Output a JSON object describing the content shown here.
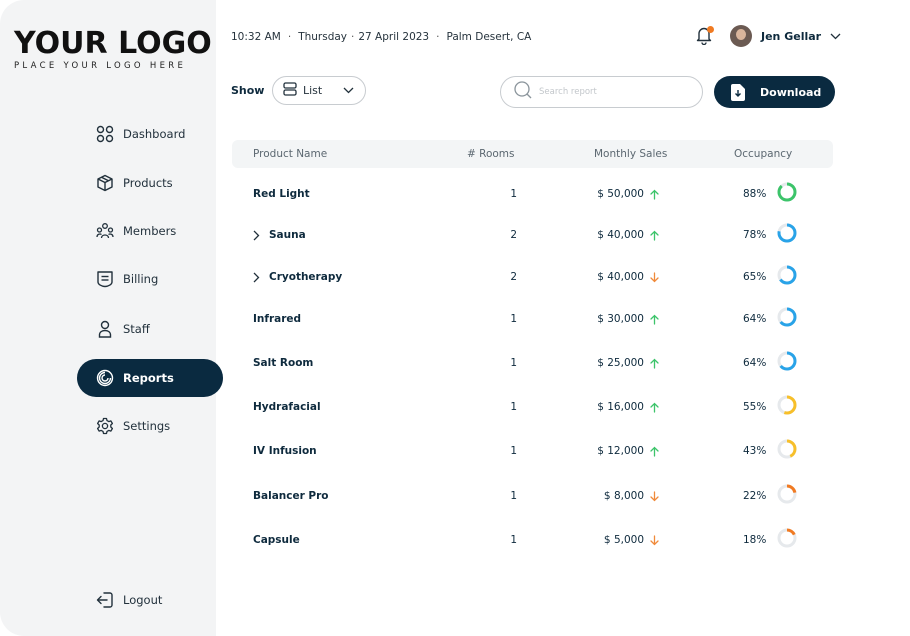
{
  "logo": {
    "main": "YOUR LOGO",
    "sub": "PLACE YOUR LOGO HERE"
  },
  "sidebar": {
    "items": [
      {
        "label": "Dashboard",
        "icon": "grid-icon"
      },
      {
        "label": "Products",
        "icon": "box-icon"
      },
      {
        "label": "Members",
        "icon": "members-icon"
      },
      {
        "label": "Billing",
        "icon": "billing-icon"
      },
      {
        "label": "Staff",
        "icon": "person-icon"
      },
      {
        "label": "Reports",
        "icon": "reports-icon",
        "active": true
      },
      {
        "label": "Settings",
        "icon": "gear-icon"
      }
    ],
    "logout_label": "Logout"
  },
  "header": {
    "time": "10:32 AM",
    "date": "Thursday",
    "date_full": "27 April 2023",
    "location": "Palm Desert, CA",
    "user_name": "Jen Gellar",
    "notification_dot_color": "#f07a22"
  },
  "controls": {
    "show_label": "Show",
    "view_value": "List",
    "search_placeholder": "Search report",
    "download_label": "Download"
  },
  "table": {
    "columns": [
      "Product Name",
      "# Rooms",
      "Monthly Sales",
      "Occupancy"
    ],
    "rows": [
      {
        "name": "Red Light",
        "rooms": "1",
        "sales": "$ 50,000",
        "trend": "up",
        "occupancy": "88%",
        "occ_value": 88,
        "expandable": false
      },
      {
        "name": "Sauna",
        "rooms": "2",
        "sales": "$ 40,000",
        "trend": "up",
        "occupancy": "78%",
        "occ_value": 78,
        "expandable": true
      },
      {
        "name": "Cryotherapy",
        "rooms": "2",
        "sales": "$ 40,000",
        "trend": "down",
        "occupancy": "65%",
        "occ_value": 65,
        "expandable": true
      },
      {
        "name": "Infrared",
        "rooms": "1",
        "sales": "$ 30,000",
        "trend": "up",
        "occupancy": "64%",
        "occ_value": 64,
        "expandable": false
      },
      {
        "name": "Salt Room",
        "rooms": "1",
        "sales": "$ 25,000",
        "trend": "up",
        "occupancy": "64%",
        "occ_value": 64,
        "expandable": false
      },
      {
        "name": "Hydrafacial",
        "rooms": "1",
        "sales": "$ 16,000",
        "trend": "up",
        "occupancy": "55%",
        "occ_value": 55,
        "expandable": false
      },
      {
        "name": "IV Infusion",
        "rooms": "1",
        "sales": "$ 12,000",
        "trend": "up",
        "occupancy": "43%",
        "occ_value": 43,
        "expandable": false
      },
      {
        "name": "Balancer Pro",
        "rooms": "1",
        "sales": "$ 8,000",
        "trend": "down",
        "occupancy": "22%",
        "occ_value": 22,
        "expandable": false
      },
      {
        "name": "Capsule",
        "rooms": "1",
        "sales": "$ 5,000",
        "trend": "down",
        "occupancy": "18%",
        "occ_value": 18,
        "expandable": false
      }
    ]
  },
  "colors": {
    "accent": "#0a2a40",
    "up": "#3cc46a",
    "down": "#f08a3a",
    "ring_green": "#3cc46a",
    "ring_blue": "#29a3e8",
    "ring_yellow": "#f7bf2a",
    "ring_orange": "#f07a22",
    "ring_track": "#e6e9ec"
  }
}
